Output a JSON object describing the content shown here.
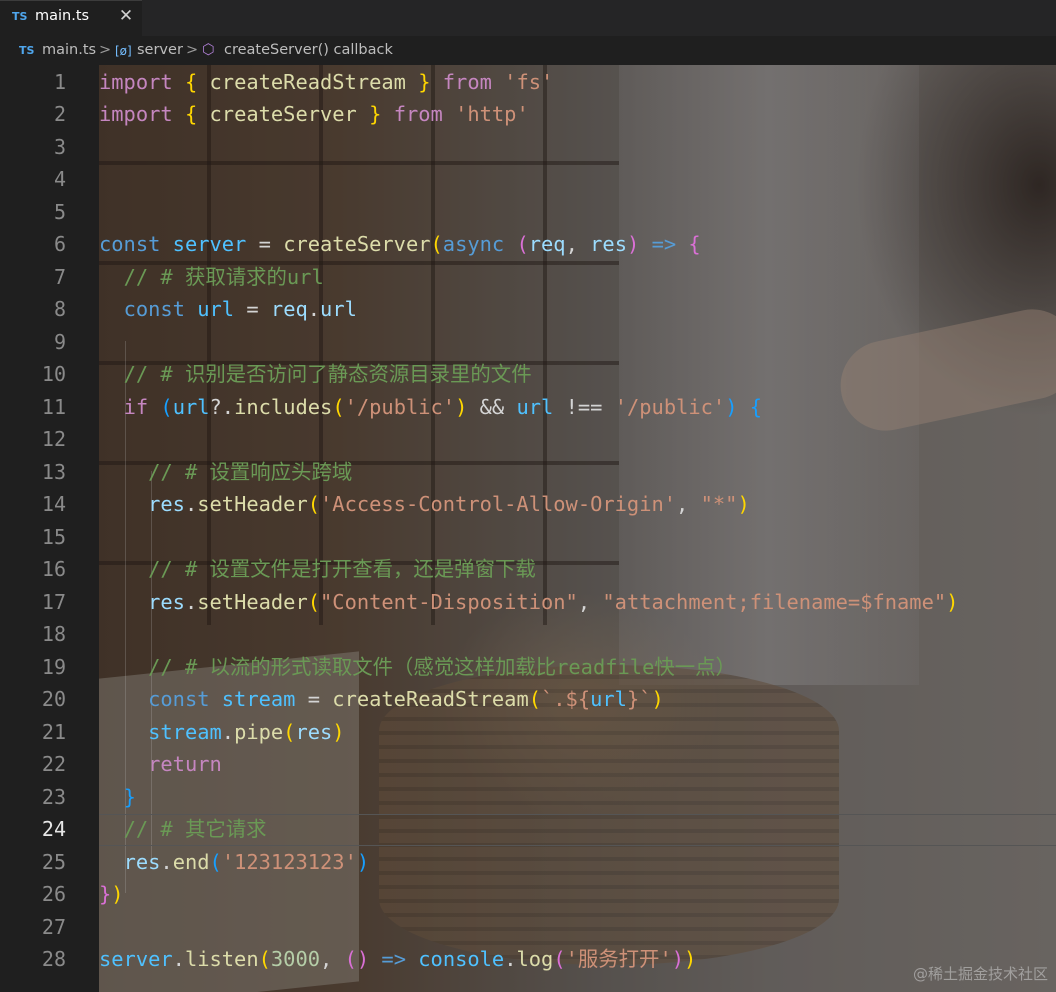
{
  "tab": {
    "badge": "TS",
    "label": "main.ts",
    "close": "✕"
  },
  "breadcrumb": {
    "file_badge": "TS",
    "file": "main.ts",
    "sep": ">",
    "var_icon": "[ø]",
    "variable": "server",
    "fn_icon": "⬡",
    "function": "createServer() callback"
  },
  "active_line": 24,
  "line_numbers": [
    "1",
    "2",
    "3",
    "4",
    "5",
    "6",
    "7",
    "8",
    "9",
    "10",
    "11",
    "12",
    "13",
    "14",
    "15",
    "16",
    "17",
    "18",
    "19",
    "20",
    "21",
    "22",
    "23",
    "24",
    "25",
    "26",
    "27",
    "28"
  ],
  "code": [
    [
      [
        "kw",
        "import"
      ],
      [
        "op",
        " "
      ],
      [
        "br1",
        "{"
      ],
      [
        "op",
        " "
      ],
      [
        "fn",
        "createReadStream"
      ],
      [
        "op",
        " "
      ],
      [
        "br1",
        "}"
      ],
      [
        "op",
        " "
      ],
      [
        "kw",
        "from"
      ],
      [
        "op",
        " "
      ],
      [
        "str",
        "'fs'"
      ]
    ],
    [
      [
        "kw",
        "import"
      ],
      [
        "op",
        " "
      ],
      [
        "br1",
        "{"
      ],
      [
        "op",
        " "
      ],
      [
        "fn",
        "createServer"
      ],
      [
        "op",
        " "
      ],
      [
        "br1",
        "}"
      ],
      [
        "op",
        " "
      ],
      [
        "kw",
        "from"
      ],
      [
        "op",
        " "
      ],
      [
        "str",
        "'http'"
      ]
    ],
    [],
    [],
    [],
    [
      [
        "dec",
        "const"
      ],
      [
        "op",
        " "
      ],
      [
        "cst",
        "server"
      ],
      [
        "op",
        " = "
      ],
      [
        "fn",
        "createServer"
      ],
      [
        "br1",
        "("
      ],
      [
        "dec",
        "async"
      ],
      [
        "op",
        " "
      ],
      [
        "br2",
        "("
      ],
      [
        "vr",
        "req"
      ],
      [
        "op",
        ", "
      ],
      [
        "vr",
        "res"
      ],
      [
        "br2",
        ")"
      ],
      [
        "op",
        " "
      ],
      [
        "dec",
        "=>"
      ],
      [
        "op",
        " "
      ],
      [
        "br2",
        "{"
      ]
    ],
    [
      [
        "op",
        "  "
      ],
      [
        "cm",
        "// # 获取请求的url"
      ]
    ],
    [
      [
        "op",
        "  "
      ],
      [
        "dec",
        "const"
      ],
      [
        "op",
        " "
      ],
      [
        "cst",
        "url"
      ],
      [
        "op",
        " = "
      ],
      [
        "vr",
        "req"
      ],
      [
        "op",
        "."
      ],
      [
        "vr",
        "url"
      ]
    ],
    [],
    [
      [
        "op",
        "  "
      ],
      [
        "cm",
        "// # 识别是否访问了静态资源目录里的文件"
      ]
    ],
    [
      [
        "op",
        "  "
      ],
      [
        "kw",
        "if"
      ],
      [
        "op",
        " "
      ],
      [
        "br3",
        "("
      ],
      [
        "cst",
        "url"
      ],
      [
        "op",
        "?."
      ],
      [
        "fn",
        "includes"
      ],
      [
        "br1",
        "("
      ],
      [
        "str",
        "'/public'"
      ],
      [
        "br1",
        ")"
      ],
      [
        "op",
        " && "
      ],
      [
        "cst",
        "url"
      ],
      [
        "op",
        " !== "
      ],
      [
        "str",
        "'/public'"
      ],
      [
        "br3",
        ")"
      ],
      [
        "op",
        " "
      ],
      [
        "br3",
        "{"
      ]
    ],
    [],
    [
      [
        "op",
        "    "
      ],
      [
        "cm",
        "// # 设置响应头跨域"
      ]
    ],
    [
      [
        "op",
        "    "
      ],
      [
        "vr",
        "res"
      ],
      [
        "op",
        "."
      ],
      [
        "fn",
        "setHeader"
      ],
      [
        "br1",
        "("
      ],
      [
        "str",
        "'Access-Control-Allow-Origin'"
      ],
      [
        "op",
        ", "
      ],
      [
        "str",
        "\"*\""
      ],
      [
        "br1",
        ")"
      ]
    ],
    [],
    [
      [
        "op",
        "    "
      ],
      [
        "cm",
        "// # 设置文件是打开查看，还是弹窗下载"
      ]
    ],
    [
      [
        "op",
        "    "
      ],
      [
        "vr",
        "res"
      ],
      [
        "op",
        "."
      ],
      [
        "fn",
        "setHeader"
      ],
      [
        "br1",
        "("
      ],
      [
        "str",
        "\"Content-Disposition\""
      ],
      [
        "op",
        ", "
      ],
      [
        "str",
        "\"attachment;filename=$fname\""
      ],
      [
        "br1",
        ")"
      ]
    ],
    [],
    [
      [
        "op",
        "    "
      ],
      [
        "cm",
        "// # 以流的形式读取文件（感觉这样加载比readfile快一点）"
      ]
    ],
    [
      [
        "op",
        "    "
      ],
      [
        "dec",
        "const"
      ],
      [
        "op",
        " "
      ],
      [
        "cst",
        "stream"
      ],
      [
        "op",
        " = "
      ],
      [
        "fn",
        "createReadStream"
      ],
      [
        "br1",
        "("
      ],
      [
        "str",
        "`.${"
      ],
      [
        "cst",
        "url"
      ],
      [
        "str",
        "}`"
      ],
      [
        "br1",
        ")"
      ]
    ],
    [
      [
        "op",
        "    "
      ],
      [
        "cst",
        "stream"
      ],
      [
        "op",
        "."
      ],
      [
        "fn",
        "pipe"
      ],
      [
        "br1",
        "("
      ],
      [
        "vr",
        "res"
      ],
      [
        "br1",
        ")"
      ]
    ],
    [
      [
        "op",
        "    "
      ],
      [
        "kw",
        "return"
      ]
    ],
    [
      [
        "op",
        "  "
      ],
      [
        "br3",
        "}"
      ]
    ],
    [
      [
        "op",
        "  "
      ],
      [
        "cm",
        "// # 其它请求"
      ]
    ],
    [
      [
        "op",
        "  "
      ],
      [
        "vr",
        "res"
      ],
      [
        "op",
        "."
      ],
      [
        "fn",
        "end"
      ],
      [
        "br3",
        "("
      ],
      [
        "str",
        "'123123123'"
      ],
      [
        "br3",
        ")"
      ]
    ],
    [
      [
        "br2",
        "}"
      ],
      [
        "br1",
        ")"
      ]
    ],
    [],
    [
      [
        "cst",
        "server"
      ],
      [
        "op",
        "."
      ],
      [
        "fn",
        "listen"
      ],
      [
        "br1",
        "("
      ],
      [
        "num",
        "3000"
      ],
      [
        "op",
        ", "
      ],
      [
        "br2",
        "()"
      ],
      [
        "op",
        " "
      ],
      [
        "dec",
        "=>"
      ],
      [
        "op",
        " "
      ],
      [
        "cst",
        "console"
      ],
      [
        "op",
        "."
      ],
      [
        "fn",
        "log"
      ],
      [
        "br2",
        "("
      ],
      [
        "str",
        "'服务打开'"
      ],
      [
        "br2",
        ")"
      ],
      [
        "br1",
        ")"
      ]
    ]
  ],
  "watermark": "@稀土掘金技术社区"
}
